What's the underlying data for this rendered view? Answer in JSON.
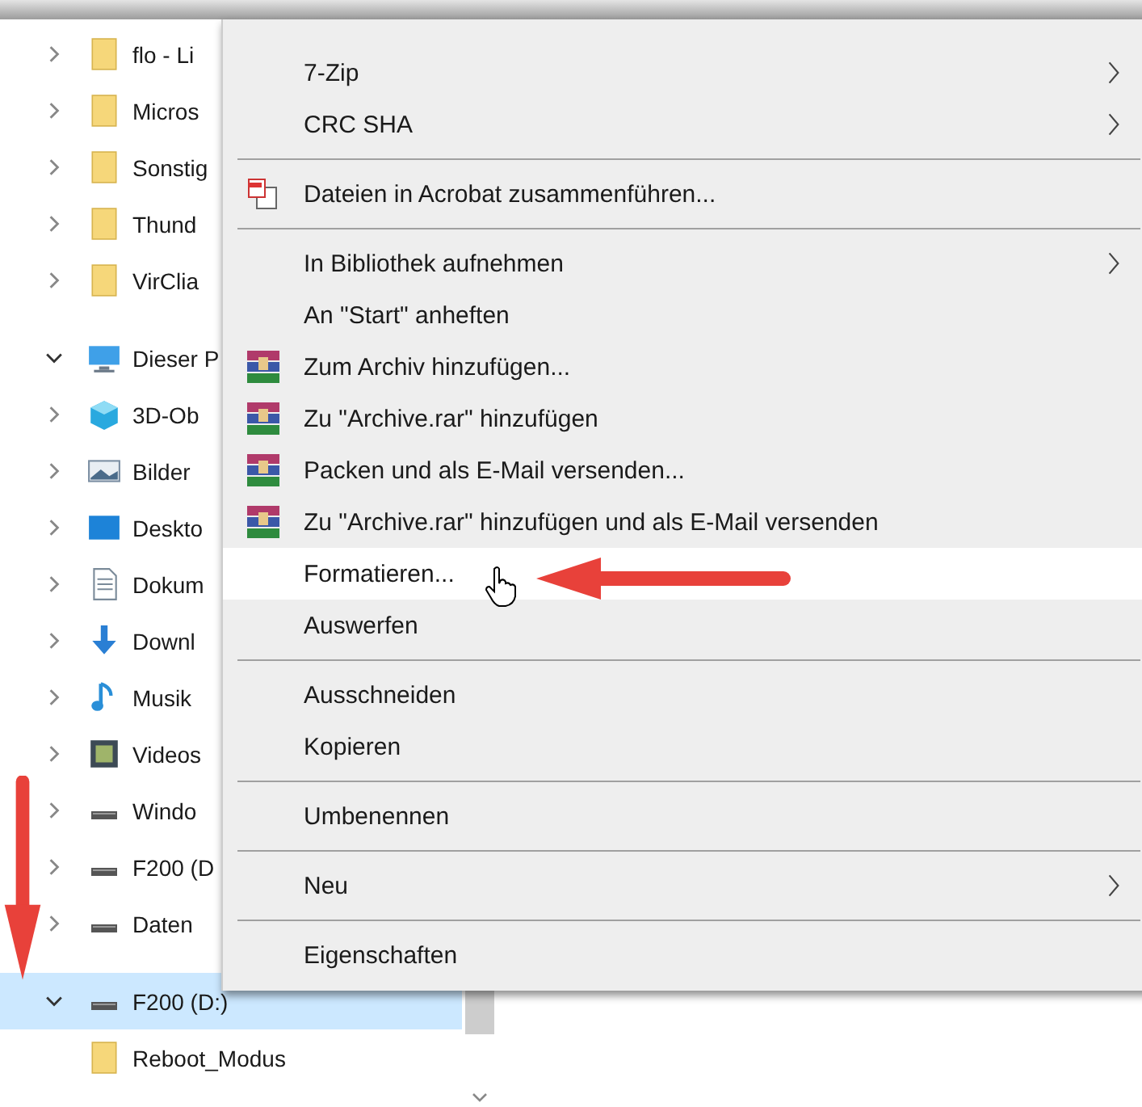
{
  "navigation_tree": [
    {
      "label": "flo - Li",
      "kind": "folder",
      "expanded": false,
      "selected": false
    },
    {
      "label": "Micros",
      "kind": "folder",
      "expanded": false,
      "selected": false
    },
    {
      "label": "Sonstig",
      "kind": "folder",
      "expanded": false,
      "selected": false
    },
    {
      "label": "Thund",
      "kind": "folder",
      "expanded": false,
      "selected": false
    },
    {
      "label": "VirClia",
      "kind": "folder",
      "expanded": false,
      "selected": false
    },
    {
      "label": "Dieser P",
      "kind": "pc",
      "expanded": true,
      "selected": false,
      "children": [
        {
          "label": "3D-Ob",
          "kind": "cube",
          "expanded": false,
          "selected": false
        },
        {
          "label": "Bilder",
          "kind": "pictures",
          "expanded": false,
          "selected": false
        },
        {
          "label": "Deskto",
          "kind": "desktop",
          "expanded": false,
          "selected": false
        },
        {
          "label": "Dokum",
          "kind": "documents",
          "expanded": false,
          "selected": false
        },
        {
          "label": "Downl",
          "kind": "downloads",
          "expanded": false,
          "selected": false
        },
        {
          "label": "Musik",
          "kind": "music",
          "expanded": false,
          "selected": false
        },
        {
          "label": "Videos",
          "kind": "videos",
          "expanded": false,
          "selected": false
        },
        {
          "label": "Windo",
          "kind": "drive",
          "expanded": false,
          "selected": false
        },
        {
          "label": "F200 (D",
          "kind": "drive",
          "expanded": false,
          "selected": false
        },
        {
          "label": "Daten",
          "kind": "drive",
          "expanded": false,
          "selected": false
        }
      ]
    },
    {
      "label": "F200 (D:)",
      "kind": "drive",
      "expanded": true,
      "selected": true,
      "children": [
        {
          "label": "Reboot_Modus",
          "kind": "folder",
          "selected": false
        }
      ]
    }
  ],
  "context_menu": [
    {
      "kind": "plain",
      "label": "7-Zip",
      "submenu": true,
      "highlighted": false
    },
    {
      "kind": "plain",
      "label": "CRC SHA",
      "submenu": true,
      "highlighted": false
    },
    {
      "kind": "separator"
    },
    {
      "kind": "acrobat",
      "label": "Dateien in Acrobat zusammenführen...",
      "submenu": false,
      "highlighted": false
    },
    {
      "kind": "separator"
    },
    {
      "kind": "plain",
      "label": "In Bibliothek aufnehmen",
      "submenu": true,
      "highlighted": false
    },
    {
      "kind": "plain",
      "label": "An \"Start\" anheften",
      "submenu": false,
      "highlighted": false
    },
    {
      "kind": "archive",
      "label": "Zum Archiv hinzufügen...",
      "submenu": false,
      "highlighted": false
    },
    {
      "kind": "archive",
      "label": "Zu \"Archive.rar\" hinzufügen",
      "submenu": false,
      "highlighted": false
    },
    {
      "kind": "archive",
      "label": "Packen und als E-Mail versenden...",
      "submenu": false,
      "highlighted": false
    },
    {
      "kind": "archive",
      "label": "Zu \"Archive.rar\" hinzufügen und als E-Mail versenden",
      "submenu": false,
      "highlighted": false
    },
    {
      "kind": "plain",
      "label": "Formatieren...",
      "submenu": false,
      "highlighted": true
    },
    {
      "kind": "plain",
      "label": "Auswerfen",
      "submenu": false,
      "highlighted": false
    },
    {
      "kind": "separator"
    },
    {
      "kind": "plain",
      "label": "Ausschneiden",
      "submenu": false,
      "highlighted": false
    },
    {
      "kind": "plain",
      "label": "Kopieren",
      "submenu": false,
      "highlighted": false
    },
    {
      "kind": "separator"
    },
    {
      "kind": "plain",
      "label": "Umbenennen",
      "submenu": false,
      "highlighted": false
    },
    {
      "kind": "separator"
    },
    {
      "kind": "plain",
      "label": "Neu",
      "submenu": true,
      "highlighted": false
    },
    {
      "kind": "separator"
    },
    {
      "kind": "plain",
      "label": "Eigenschaften",
      "submenu": false,
      "highlighted": false
    }
  ]
}
